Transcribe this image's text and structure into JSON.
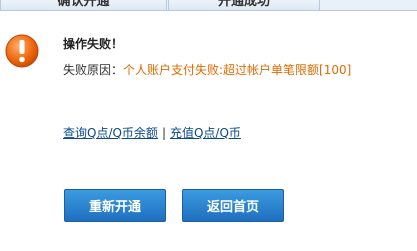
{
  "tabs": [
    {
      "label": "确认开通"
    },
    {
      "label": "开通成功"
    }
  ],
  "message": {
    "icon": "alert-icon",
    "title": "操作失败！",
    "reason_label": "失败原因：",
    "reason_text": "个人账户支付失败:超过帐户单笔限额[100]"
  },
  "links": {
    "query_balance": "查询Q点/Q币余额",
    "separator": "|",
    "recharge": "充值Q点/Q币"
  },
  "buttons": {
    "reopen": "重新开通",
    "home": "返回首页"
  },
  "colors": {
    "accent_orange": "#e06b00",
    "link_blue": "#0b4a8a",
    "button_blue": "#1f6fbf"
  }
}
